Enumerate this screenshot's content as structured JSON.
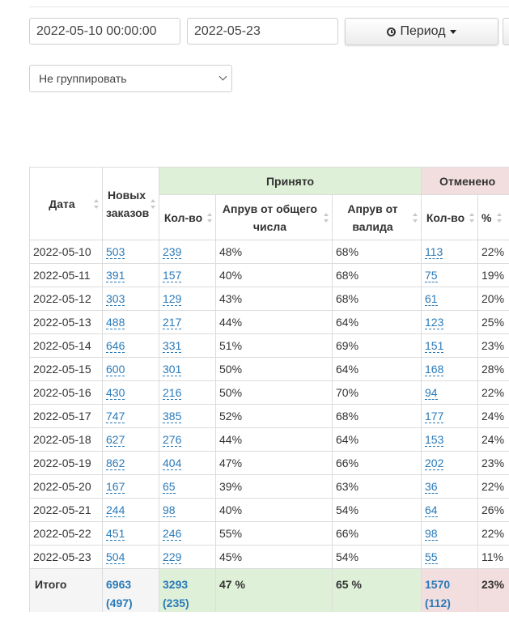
{
  "filters": {
    "date_from": "2022-05-10 00:00:00",
    "date_to": "2022-05-23",
    "period_label": "Период",
    "group_by": "Не группировать"
  },
  "table": {
    "headers": {
      "date": "Дата",
      "new_orders": "Новых заказов",
      "accepted": "Принято",
      "cancelled": "Отменено",
      "acc_count": "Кол-во",
      "acc_approve_total": "Апрув от общего числа",
      "acc_approve_valid": "Апрув от валида",
      "can_count": "Кол-во",
      "can_percent": "%"
    },
    "rows": [
      [
        "2022-05-10",
        "503",
        "239",
        "48%",
        "68%",
        "113",
        "22%"
      ],
      [
        "2022-05-11",
        "391",
        "157",
        "40%",
        "68%",
        "75",
        "19%"
      ],
      [
        "2022-05-12",
        "303",
        "129",
        "43%",
        "68%",
        "61",
        "20%"
      ],
      [
        "2022-05-13",
        "488",
        "217",
        "44%",
        "64%",
        "123",
        "25%"
      ],
      [
        "2022-05-14",
        "646",
        "331",
        "51%",
        "69%",
        "151",
        "23%"
      ],
      [
        "2022-05-15",
        "600",
        "301",
        "50%",
        "64%",
        "168",
        "28%"
      ],
      [
        "2022-05-16",
        "430",
        "216",
        "50%",
        "70%",
        "94",
        "22%"
      ],
      [
        "2022-05-17",
        "747",
        "385",
        "52%",
        "68%",
        "177",
        "24%"
      ],
      [
        "2022-05-18",
        "627",
        "276",
        "44%",
        "64%",
        "153",
        "24%"
      ],
      [
        "2022-05-19",
        "862",
        "404",
        "47%",
        "66%",
        "202",
        "23%"
      ],
      [
        "2022-05-20",
        "167",
        "65",
        "39%",
        "63%",
        "36",
        "22%"
      ],
      [
        "2022-05-21",
        "244",
        "98",
        "40%",
        "54%",
        "64",
        "26%"
      ],
      [
        "2022-05-22",
        "451",
        "246",
        "55%",
        "66%",
        "98",
        "22%"
      ],
      [
        "2022-05-23",
        "504",
        "229",
        "45%",
        "54%",
        "55",
        "11%"
      ]
    ],
    "total": {
      "label": "Итого",
      "new_orders": "6963",
      "new_orders_avg": "(497)",
      "acc_count": "3293",
      "acc_count_avg": "(235)",
      "acc_approve_total": "47 %",
      "acc_approve_valid": "65 %",
      "can_count": "1570",
      "can_count_avg": "(112)",
      "can_percent": "23%"
    }
  },
  "colors": {
    "link": "#2a7ab8",
    "accepted_bg": "#dff0d8",
    "cancelled_bg": "#f2dede"
  }
}
